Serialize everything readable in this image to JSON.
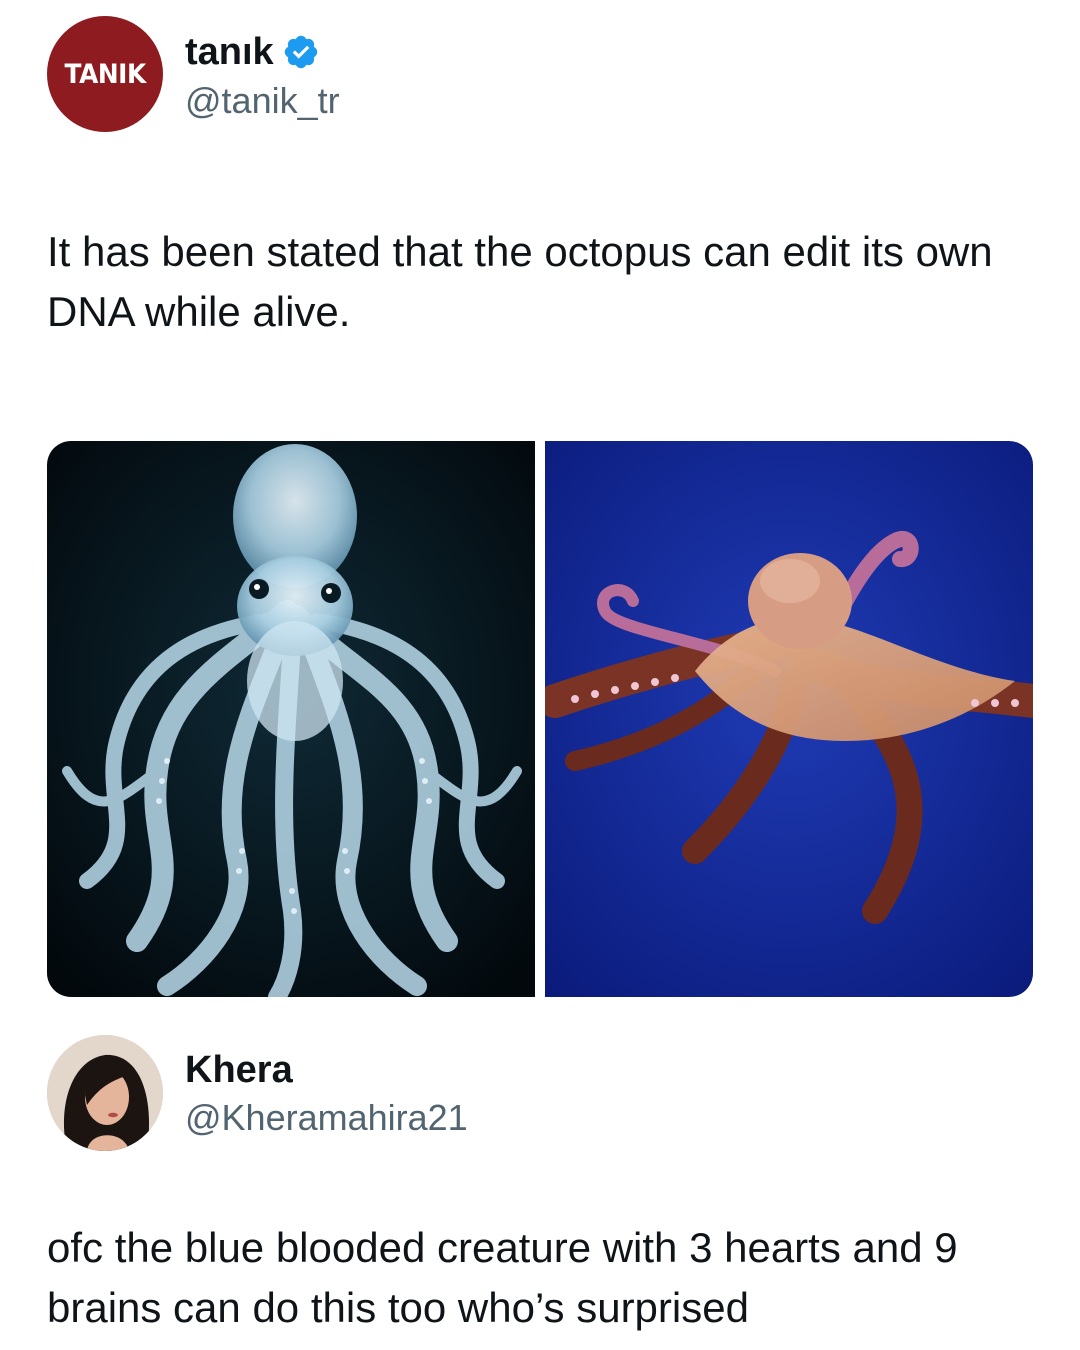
{
  "post": {
    "avatar_text": "TANIK",
    "author_name": "tanık",
    "author_handle": "@tanik_tr",
    "verified": true,
    "text": "It has been stated that the octopus can edit its own DNA while alive.",
    "media": [
      {
        "description_icon": "octopus-translucent-image"
      },
      {
        "description_icon": "octopus-red-image"
      }
    ]
  },
  "reply": {
    "author_name": "Khera",
    "author_handle": "@Kheramahira21",
    "text": "ofc the blue blooded creature with 3 hearts and 9 brains can do this too who’s surprised"
  },
  "colors": {
    "tanik_brand": "#8e1b1f",
    "verified_blue": "#1d9bf0",
    "text_primary": "#0f1419",
    "text_secondary": "#536471"
  }
}
